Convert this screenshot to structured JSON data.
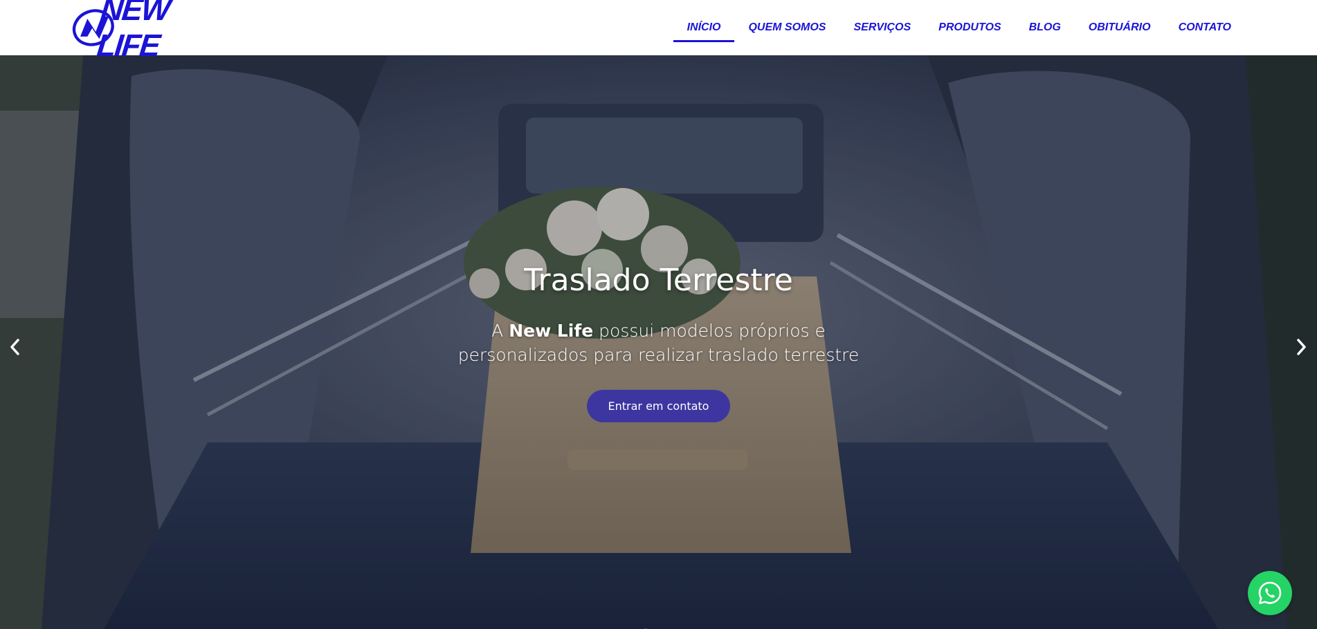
{
  "brand": {
    "name": "NEW LIFE",
    "color": "#1b14d6"
  },
  "nav": {
    "items": [
      {
        "label": "INÍCIO",
        "active": true
      },
      {
        "label": "QUEM SOMOS",
        "active": false
      },
      {
        "label": "SERVIÇOS",
        "active": false
      },
      {
        "label": "PRODUTOS",
        "active": false
      },
      {
        "label": "BLOG",
        "active": false
      },
      {
        "label": "OBITUÁRIO",
        "active": false
      },
      {
        "label": "CONTATO",
        "active": false
      }
    ]
  },
  "hero": {
    "title": "Traslado Terrestre",
    "subtitle_before": "A ",
    "subtitle_bold": "New Life",
    "subtitle_after": " possui modelos próprios e personalizados para realizar traslado terrestre",
    "cta_label": "Entrar em contato",
    "cta_color": "#3d36a0",
    "prev_icon": "chevron-left-icon",
    "next_icon": "chevron-right-icon",
    "slide_count": 3,
    "active_slide": 1
  },
  "floating": {
    "icon": "whatsapp-icon",
    "color": "#25d366"
  }
}
